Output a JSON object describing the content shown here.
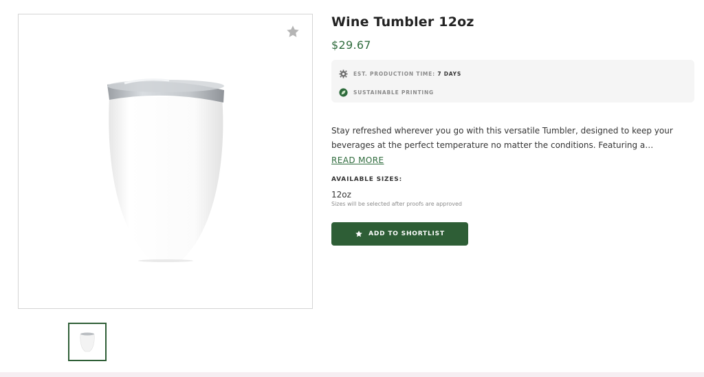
{
  "product": {
    "title": "Wine Tumbler 12oz",
    "price": "$29.67",
    "info": [
      {
        "icon": "gear-icon",
        "label": "EST. PRODUCTION TIME:",
        "value": "7 DAYS"
      },
      {
        "icon": "leaf-icon",
        "label": "SUSTAINABLE PRINTING",
        "value": ""
      }
    ],
    "description": "Stay refreshed wherever you go with this versatile Tumbler, designed to keep your beverages at the perfect temperature no matter the conditions. Featuring a…",
    "read_more": "READ MORE",
    "sizes": {
      "label": "AVAILABLE SIZES:",
      "value": "12oz",
      "note": "Sizes will be selected after proofs are approved"
    },
    "add_button": "ADD TO SHORTLIST"
  },
  "colors": {
    "brand_green": "#2e5e36",
    "price_green": "#2e6b3c"
  }
}
